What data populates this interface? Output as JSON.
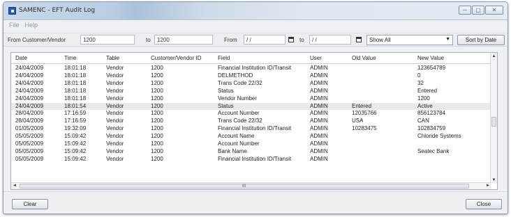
{
  "window": {
    "title": "SAMENC - EFT Audit Log"
  },
  "titlebar_buttons": {
    "minimize": "─",
    "maximize": "▢",
    "close": "✕"
  },
  "menu": [
    {
      "label": "File"
    },
    {
      "label": "Help"
    }
  ],
  "filters": {
    "from_vendor_label": "From Customer/Vendor",
    "from_vendor_value": "1200",
    "to_vendor_label": "to",
    "to_vendor_value": "1200",
    "from_date_label": "From",
    "from_date_value": " / /",
    "to_date_label": "to",
    "to_date_value": " / /",
    "show_select": "Show All",
    "sort_button": "Sort by Date"
  },
  "columns": [
    "Date",
    "Time",
    "Table",
    "Customer/Vendor ID",
    "Field",
    "User",
    "Old Value",
    "New Value"
  ],
  "rows": [
    [
      "24/04/2009",
      "18:01:18",
      "Vendor",
      "1200",
      "Financial Institution ID/Transit",
      "ADMIN",
      "",
      "123654789"
    ],
    [
      "24/04/2009",
      "18:01:18",
      "Vendor",
      "1200",
      "DELMETHOD",
      "ADMIN",
      "",
      "0"
    ],
    [
      "24/04/2009",
      "18:01:18",
      "Vendor",
      "1200",
      "Trans Code 22/32",
      "ADMIN",
      "",
      "32"
    ],
    [
      "24/04/2009",
      "18:01:18",
      "Vendor",
      "1200",
      "Status",
      "ADMIN",
      "",
      "Entered"
    ],
    [
      "24/04/2009",
      "18:01:18",
      "Vendor",
      "1200",
      "Vendor Number",
      "ADMIN",
      "",
      "1200"
    ],
    [
      "24/04/2009",
      "18:01:54",
      "Vendor",
      "1200",
      "Status",
      "ADMIN",
      "Entered",
      "Active"
    ],
    [
      "28/04/2009",
      "17:16:59",
      "Vendor",
      "1200",
      "Account Number",
      "ADMIN",
      "12035766",
      "856123784"
    ],
    [
      "28/04/2009",
      "17:16:59",
      "Vendor",
      "1200",
      "Trans Code 22/32",
      "ADMIN",
      "USA",
      "CAN"
    ],
    [
      "01/05/2009",
      "19:32:09",
      "Vendor",
      "1200",
      "Financial Institution ID/Transit",
      "ADMIN",
      "10283475",
      "102834759"
    ],
    [
      "05/05/2009",
      "15:09:42",
      "Vendor",
      "1200",
      "Account Name",
      "ADMIN",
      "",
      "Chloride Systems"
    ],
    [
      "05/05/2009",
      "15:09:42",
      "Vendor",
      "1200",
      "Account Number",
      "ADMIN",
      "",
      ""
    ],
    [
      "05/05/2009",
      "15:09:42",
      "Vendor",
      "1200",
      "Bank Name",
      "ADMIN",
      "",
      "Seatec Bank"
    ],
    [
      "05/05/2009",
      "15:09:42",
      "Vendor",
      "1200",
      "Financial Institution ID/Transit",
      "ADMIN",
      "",
      ""
    ]
  ],
  "selected_row": 5,
  "scroll_glyphs": {
    "up": "▲",
    "down": "▼",
    "left": "◄",
    "right": "►",
    "grip": "III"
  },
  "buttons": {
    "clear": "Clear",
    "close": "Close"
  }
}
